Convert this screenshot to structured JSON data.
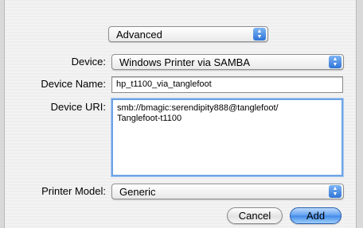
{
  "mode_popup": {
    "value": "Advanced",
    "arrows_icon": "up-down-arrows-icon"
  },
  "device": {
    "label": "Device:",
    "value": "Windows Printer via SAMBA",
    "arrows_icon": "up-down-arrows-icon"
  },
  "device_name": {
    "label": "Device Name:",
    "value": "hp_t1100_via_tanglefoot"
  },
  "device_uri": {
    "label": "Device URI:",
    "value": "smb://bmagic:serendipity888@tanglefoot/\nTanglefoot-t1100"
  },
  "printer_model": {
    "label": "Printer Model:",
    "value": "Generic",
    "arrows_icon": "up-down-arrows-icon"
  },
  "buttons": {
    "cancel": "Cancel",
    "add": "Add"
  },
  "colors": {
    "accent": "#3f88e8",
    "focus_ring": "#6ea4e6",
    "sheet": "#eeeeee"
  }
}
